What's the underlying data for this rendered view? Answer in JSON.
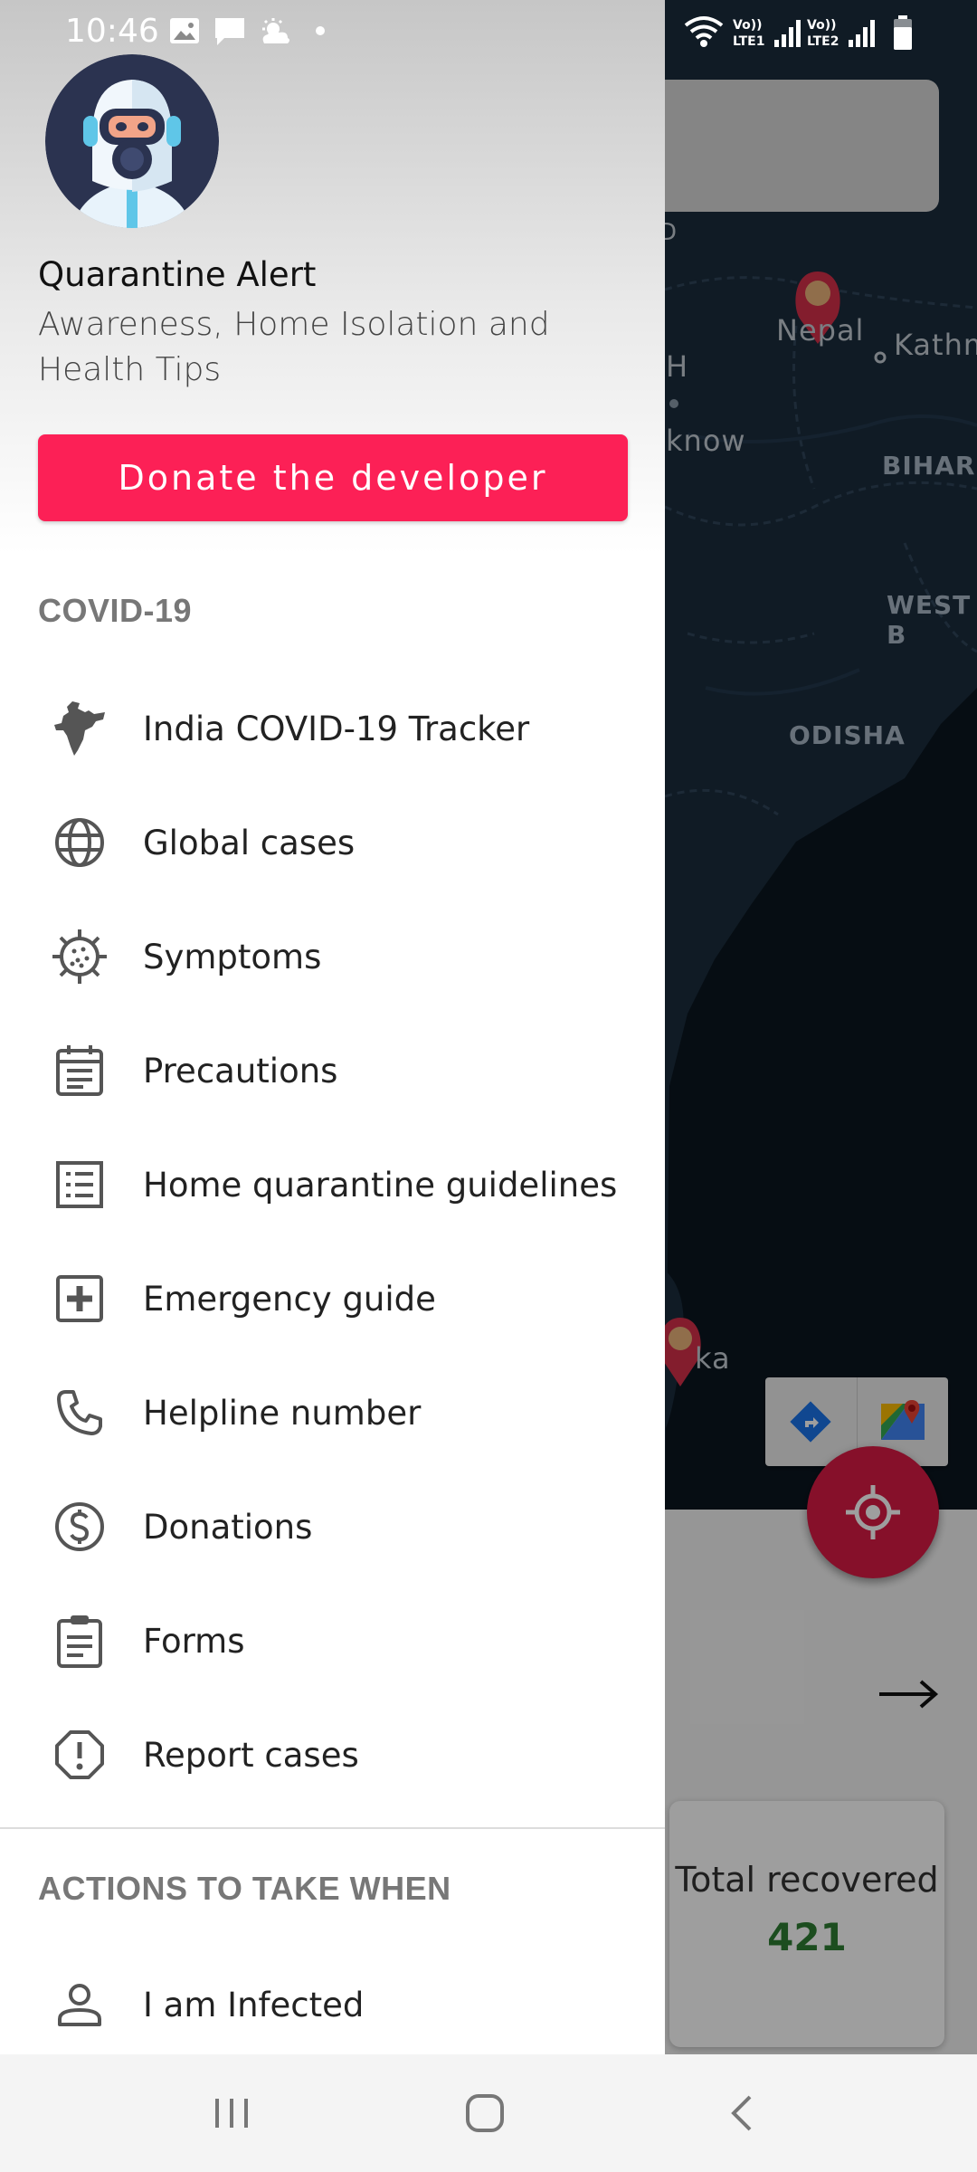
{
  "status_bar": {
    "time": "10:46"
  },
  "drawer": {
    "app_title": "Quarantine Alert",
    "app_subtitle": "Awareness, Home Isolation and Health Tips",
    "donate_label": "Donate the developer",
    "sections": [
      {
        "header": "COVID-19",
        "items": [
          {
            "label": "India COVID-19 Tracker",
            "icon": "india-map-icon"
          },
          {
            "label": "Global cases",
            "icon": "globe-icon"
          },
          {
            "label": "Symptoms",
            "icon": "virus-icon"
          },
          {
            "label": "Precautions",
            "icon": "calendar-note-icon"
          },
          {
            "label": "Home quarantine guidelines",
            "icon": "list-icon"
          },
          {
            "label": "Emergency guide",
            "icon": "plus-box-icon"
          },
          {
            "label": "Helpline number",
            "icon": "phone-icon"
          },
          {
            "label": "Donations",
            "icon": "dollar-circle-icon"
          },
          {
            "label": "Forms",
            "icon": "clipboard-icon"
          },
          {
            "label": "Report cases",
            "icon": "alert-octagon-icon"
          }
        ]
      },
      {
        "header": "ACTIONS TO TAKE WHEN",
        "items": [
          {
            "label": "I am Infected",
            "icon": "person-icon"
          }
        ]
      }
    ]
  },
  "map": {
    "labels": [
      "Nepal",
      "Kathm",
      "H",
      "know",
      "BIHAR",
      "WEST B",
      "ODISHA",
      "ka",
      "D"
    ],
    "colors": {
      "water": "#0b1620",
      "land": "#1a2c3c",
      "marker": "#d32f4a"
    }
  },
  "stats": {
    "total_recovered_label": "Total recovered",
    "total_recovered_value": "421"
  },
  "colors": {
    "accent": "#fc2056",
    "fab": "#d81b45",
    "recovered": "#2e7d32"
  }
}
